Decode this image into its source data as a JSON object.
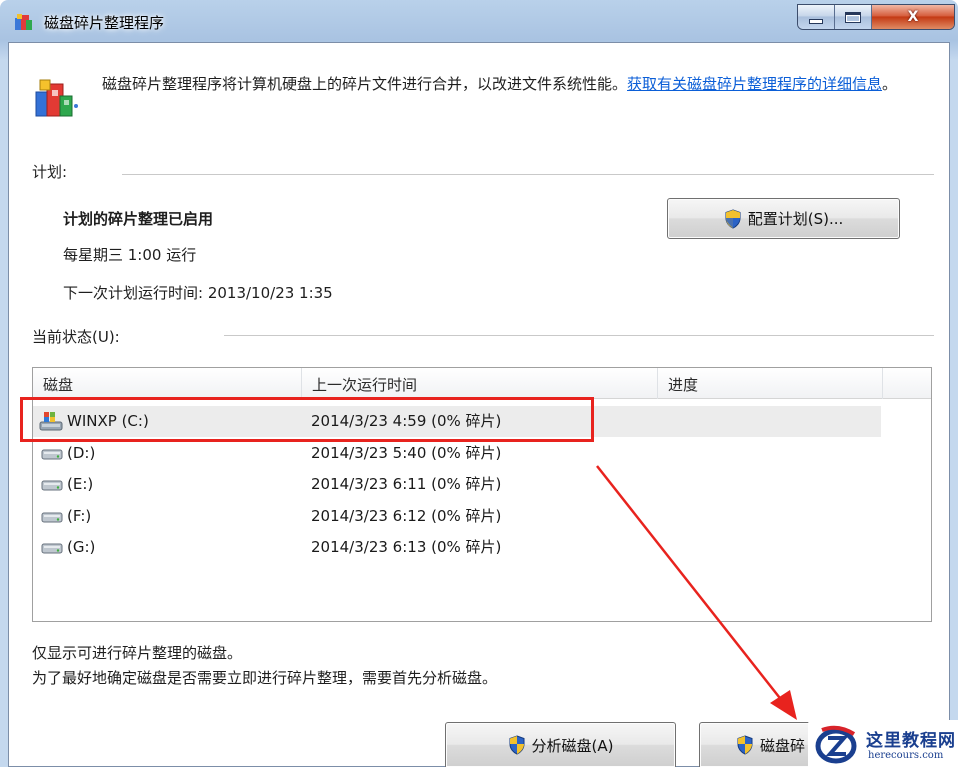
{
  "window": {
    "title": "磁盘碎片整理程序",
    "close_glyph": "X"
  },
  "header": {
    "description": "磁盘碎片整理程序将计算机硬盘上的碎片文件进行合并，以改进文件系统性能。",
    "link_text": "获取有关磁盘碎片整理程序的详细信息",
    "link_suffix": "。"
  },
  "schedule": {
    "group_label": "计划:",
    "status": "计划的碎片整理已启用",
    "frequency": "每星期三  1:00 运行",
    "next_run": "下一次计划运行时间: 2013/10/23 1:35",
    "configure_button": "配置计划(S)..."
  },
  "current_status": {
    "group_label": "当前状态(U):",
    "columns": [
      "磁盘",
      "上一次运行时间",
      "进度"
    ],
    "rows": [
      {
        "disk": "WINXP (C:)",
        "last_run": "2014/3/23 4:59 (0% 碎片)",
        "progress": "",
        "icon": "windows-drive-icon",
        "selected": true
      },
      {
        "disk": "(D:)",
        "last_run": "2014/3/23 5:40 (0% 碎片)",
        "progress": "",
        "icon": "hard-drive-icon",
        "selected": false
      },
      {
        "disk": "(E:)",
        "last_run": "2014/3/23 6:11 (0% 碎片)",
        "progress": "",
        "icon": "hard-drive-icon",
        "selected": false
      },
      {
        "disk": "(F:)",
        "last_run": "2014/3/23 6:12 (0% 碎片)",
        "progress": "",
        "icon": "hard-drive-icon",
        "selected": false
      },
      {
        "disk": "(G:)",
        "last_run": "2014/3/23 6:13 (0% 碎片)",
        "progress": "",
        "icon": "hard-drive-icon",
        "selected": false
      }
    ]
  },
  "notes": {
    "line1": "仅显示可进行碎片整理的磁盘。",
    "line2": "为了最好地确定磁盘是否需要立即进行碎片整理，需要首先分析磁盘。"
  },
  "actions": {
    "analyze_button": "分析磁盘(A)",
    "defrag_button": "磁盘碎"
  },
  "watermark": {
    "name": "这里教程网",
    "domain": "herecours.com"
  },
  "colors": {
    "annotation": "#e8231e",
    "link": "#0b5ed7",
    "title_brand": "#1a3f8f"
  }
}
